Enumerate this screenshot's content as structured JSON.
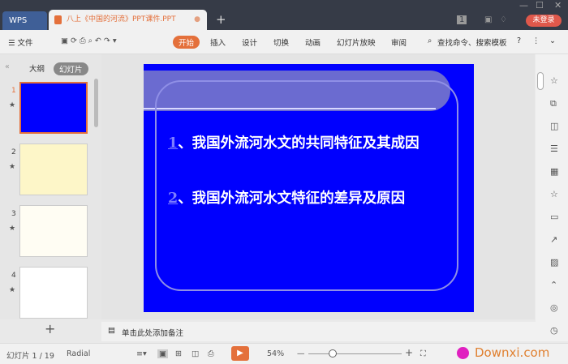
{
  "titlebar": {
    "wps_tab": "WPS",
    "doc_tab": "八上《中国的河流》PPT课件.PPT",
    "new_tab": "+",
    "login": "未登录",
    "badge": "1"
  },
  "toolbar": {
    "file": "☰ 文件",
    "tabs": [
      "开始",
      "插入",
      "设计",
      "切换",
      "动画",
      "幻灯片放映",
      "审阅"
    ],
    "search": "查找命令、搜索模板",
    "help": "?"
  },
  "leftpanel": {
    "outline": "大纲",
    "slides": "幻灯片",
    "numbers": [
      "1",
      "2",
      "3",
      "4"
    ],
    "add": "+"
  },
  "slide": {
    "items": [
      {
        "num": "1",
        "text": "、我国外流河水文的共同特征及其成因"
      },
      {
        "num": "2",
        "text": "、我国外流河水文特征的差异及原因"
      }
    ]
  },
  "notes": {
    "placeholder": "单击此处添加备注"
  },
  "status": {
    "slide_count": "幻灯片 1 / 19",
    "theme": "Radial",
    "zoom": "54%",
    "watermark": "Downxi.com"
  }
}
